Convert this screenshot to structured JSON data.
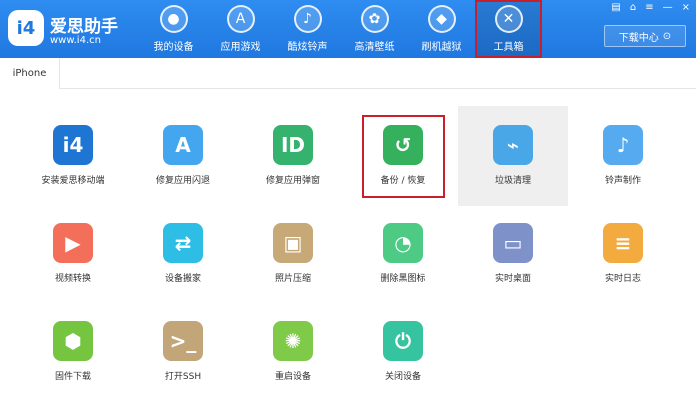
{
  "brand": {
    "name": "爱思助手",
    "url": "www.i4.cn"
  },
  "nav": [
    {
      "label": "我的设备",
      "icon": "apple-icon"
    },
    {
      "label": "应用游戏",
      "icon": "app-store-icon"
    },
    {
      "label": "酷炫铃声",
      "icon": "bell-icon"
    },
    {
      "label": "高清壁纸",
      "icon": "flower-icon"
    },
    {
      "label": "刷机越狱",
      "icon": "dropbox-icon"
    },
    {
      "label": "工具箱",
      "icon": "tools-icon"
    }
  ],
  "download": {
    "label": "下载中心"
  },
  "tabs": [
    {
      "label": "iPhone"
    }
  ],
  "tools": [
    {
      "label": "安装爱思移动端",
      "icon": "i4-icon",
      "color": "#1f76d2"
    },
    {
      "label": "修复应用闪退",
      "icon": "app-store-icon",
      "color": "#44a6ee"
    },
    {
      "label": "修复应用弹窗",
      "icon": "apple-id-icon",
      "color": "#34b26e"
    },
    {
      "label": "备份 / 恢复",
      "icon": "backup-restore-icon",
      "color": "#35b15d"
    },
    {
      "label": "垃圾清理",
      "icon": "broom-icon",
      "color": "#49a7e7"
    },
    {
      "label": "铃声制作",
      "icon": "bell-icon",
      "color": "#55aaf0"
    },
    {
      "label": "视频转换",
      "icon": "video-icon",
      "color": "#f36f59"
    },
    {
      "label": "设备搬家",
      "icon": "transfer-icon",
      "color": "#2dbde5"
    },
    {
      "label": "照片压缩",
      "icon": "photo-icon",
      "color": "#c7a877"
    },
    {
      "label": "删除黑图标",
      "icon": "timer-icon",
      "color": "#4dcb84"
    },
    {
      "label": "实时桌面",
      "icon": "monitor-icon",
      "color": "#7e91c8"
    },
    {
      "label": "实时日志",
      "icon": "document-icon",
      "color": "#f3aa3f"
    },
    {
      "label": "固件下载",
      "icon": "box-icon",
      "color": "#76c540"
    },
    {
      "label": "打开SSH",
      "icon": "terminal-icon",
      "color": "#c2a67a"
    },
    {
      "label": "重启设备",
      "icon": "loading-icon",
      "color": "#7fcb49"
    },
    {
      "label": "关闭设备",
      "icon": "power-icon",
      "color": "#36c4a0"
    }
  ]
}
